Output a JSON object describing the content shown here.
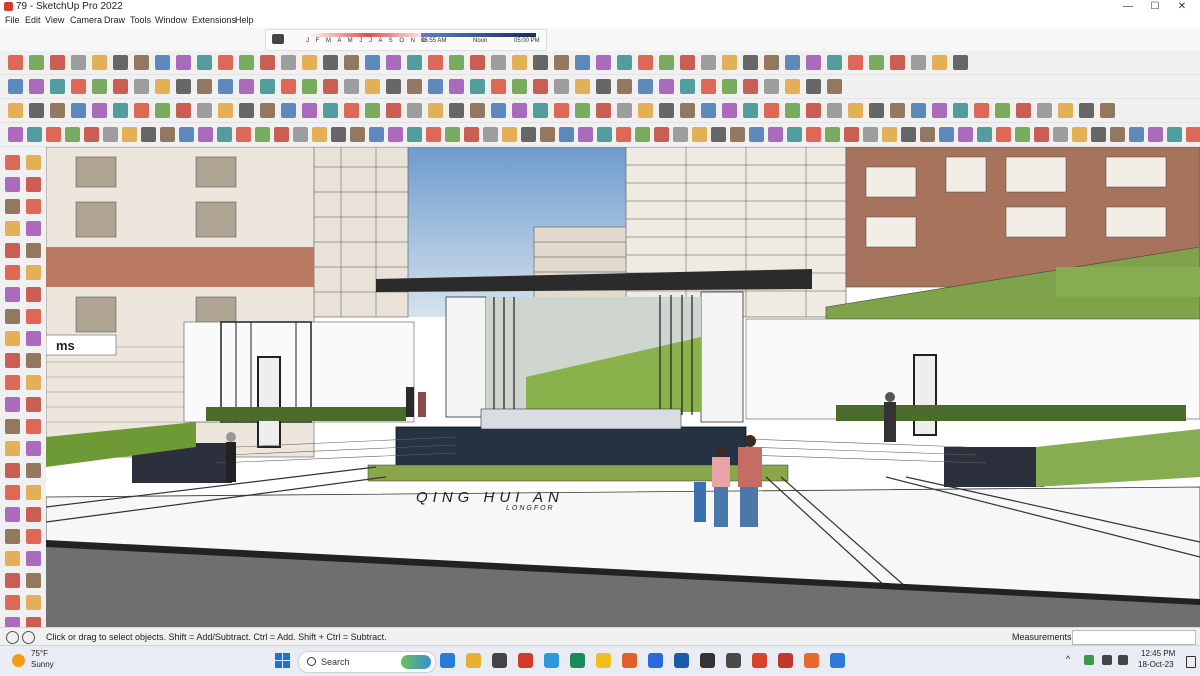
{
  "window": {
    "title": "79 - SketchUp Pro 2022",
    "minimize": "—",
    "maximize": "☐",
    "close": "✕"
  },
  "menu": [
    "File",
    "Edit",
    "View",
    "Camera",
    "Draw",
    "Tools",
    "Window",
    "Extensions",
    "Help"
  ],
  "shadows": {
    "months": "J F M A M J J A S O N D",
    "time_start": "06:55 AM",
    "time_mid": "Noon",
    "time_end": "05:00 PM"
  },
  "scene": {
    "signage": "QING HUI AN",
    "sub_signage": "LONGFOR",
    "shop_sign": "ms"
  },
  "status": {
    "message": "Click or drag to select objects. Shift = Add/Subtract. Ctrl = Add. Shift + Ctrl = Subtract.",
    "measurements_label": "Measurements",
    "measurements_value": ""
  },
  "taskbar": {
    "weather_temp": "75°F",
    "weather_condition": "Sunny",
    "search_label": "Search",
    "time": "12:45 PM",
    "date": "18-Oct-23"
  },
  "colors": {
    "ui_bg": "#f0f0f0",
    "sky": "#8fb4d8",
    "grass": "#6e9a36",
    "accent": "#1a73d9"
  }
}
